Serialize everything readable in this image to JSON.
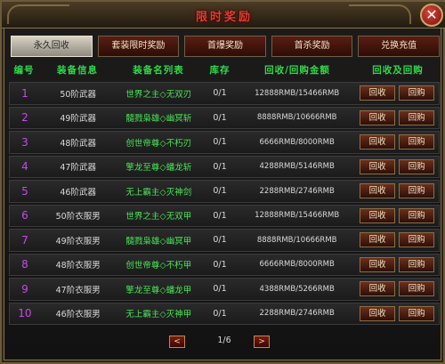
{
  "window": {
    "title": "限时奖励",
    "close_label": "✕"
  },
  "tabs": [
    {
      "label": "永久回收",
      "active": true
    },
    {
      "label": "套装限时奖励",
      "active": false
    },
    {
      "label": "首爆奖励",
      "active": false
    },
    {
      "label": "首杀奖励",
      "active": false
    },
    {
      "label": "兑换充值",
      "active": false
    }
  ],
  "columns": [
    "编号",
    "装备信息",
    "装备名列表",
    "库存",
    "回收/回购金额",
    "回收及回购"
  ],
  "rows": [
    {
      "no": "1",
      "item": "50阶武器",
      "name": "世界之主◇无双刃",
      "stock": "0/1",
      "price": "12888RMB/15466RMB"
    },
    {
      "no": "2",
      "item": "49阶武器",
      "name": "髓戮枭雄◇幽冥斩",
      "stock": "0/1",
      "price": "8888RMB/10666RMB"
    },
    {
      "no": "3",
      "item": "48阶武器",
      "name": "创世帝尊◇不朽刃",
      "stock": "0/1",
      "price": "6666RMB/8000RMB"
    },
    {
      "no": "4",
      "item": "47阶武器",
      "name": "擎龙至尊◇蟠龙斩",
      "stock": "0/1",
      "price": "4288RMB/5146RMB"
    },
    {
      "no": "5",
      "item": "46阶武器",
      "name": "无上霸主◇灭神剑",
      "stock": "0/1",
      "price": "2288RMB/2746RMB"
    },
    {
      "no": "6",
      "item": "50阶衣服男",
      "name": "世界之主◇无双甲",
      "stock": "0/1",
      "price": "12888RMB/15466RMB"
    },
    {
      "no": "7",
      "item": "49阶衣服男",
      "name": "髓戮枭雄◇幽冥甲",
      "stock": "0/1",
      "price": "8888RMB/10666RMB"
    },
    {
      "no": "8",
      "item": "48阶衣服男",
      "name": "创世帝尊◇不朽甲",
      "stock": "0/1",
      "price": "6666RMB/8000RMB"
    },
    {
      "no": "9",
      "item": "47阶衣服男",
      "name": "擎龙至尊◇蟠龙甲",
      "stock": "0/1",
      "price": "4388RMB/5266RMB"
    },
    {
      "no": "10",
      "item": "46阶衣服男",
      "name": "无上霸主◇灭神甲",
      "stock": "0/1",
      "price": "2288RMB/2746RMB"
    }
  ],
  "actions": {
    "recycle": "回收",
    "buyback": "回购"
  },
  "pager": {
    "prev": "<",
    "next": ">",
    "info": "1/6"
  }
}
